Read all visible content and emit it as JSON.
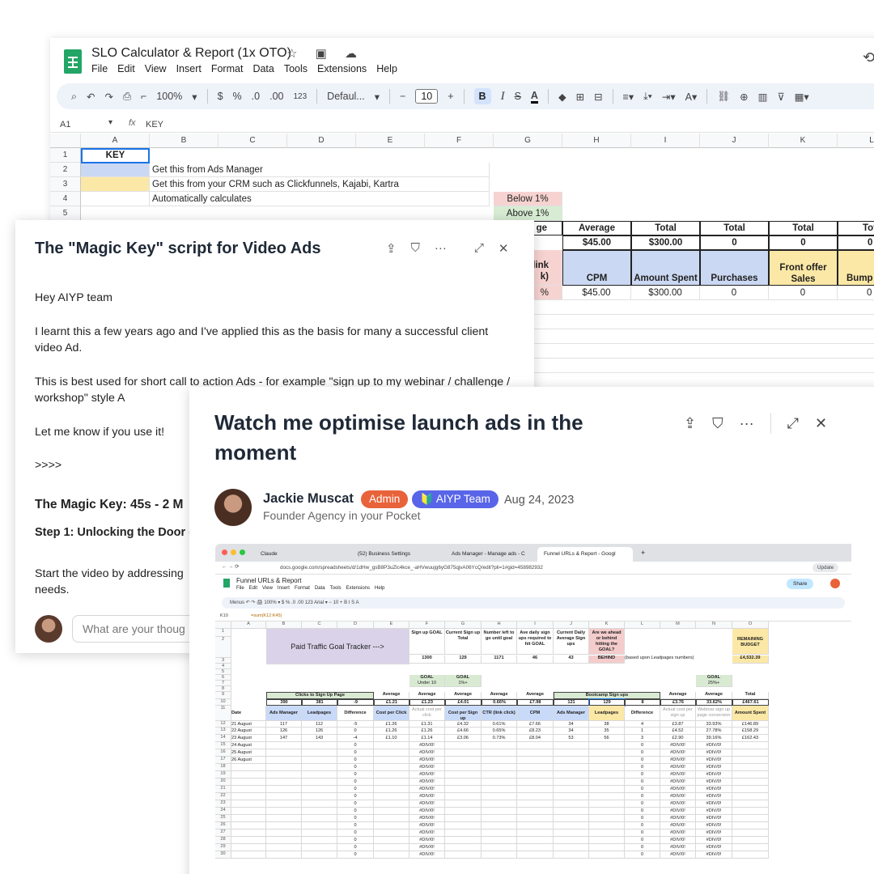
{
  "sheets": {
    "title": "SLO Calculator & Report (1x OTO)",
    "title_icons": "☆ ▣ ☁",
    "menu": [
      "File",
      "Edit",
      "View",
      "Insert",
      "Format",
      "Data",
      "Tools",
      "Extensions",
      "Help"
    ],
    "toolbar": {
      "zoom": "100%",
      "currency": "$",
      "percent": "%",
      "dec_less": ".0",
      "dec_more": ".00",
      "num_format": "123",
      "font": "Defaul...",
      "font_size": "10",
      "bold": "B",
      "italic": "I",
      "strike": "S",
      "text_color": "A"
    },
    "name_box": "A1",
    "fx": "fx",
    "formula_value": "KEY",
    "columns": [
      "A",
      "B",
      "C",
      "D",
      "E",
      "F",
      "G",
      "H",
      "I",
      "J",
      "K",
      "L"
    ],
    "rows": [
      "1",
      "2",
      "3",
      "4",
      "5"
    ],
    "cells": {
      "a1": "KEY",
      "b2": "Get this from Ads Manager",
      "b3": "Get this from your CRM such as Clickfunnels, Kajabi, Kartra",
      "b4": "Automatically calculates",
      "g4": "Below 1%",
      "g5": "Above 1%"
    },
    "summary": {
      "g_partial": "ge",
      "h_label": "Average",
      "h_value": "$45.00",
      "i_label": "Total",
      "i_value": "$300.00",
      "j_label": "Total",
      "j_value": "0",
      "k_label": "Total",
      "k_value": "0",
      "l_label": "Tot",
      "l_value": "0"
    },
    "headers": {
      "g_partial_1": "link",
      "g_partial_2": "k)",
      "h": "CPM",
      "i": "Amount Spent",
      "j": "Purchases",
      "k_1": "Front offer",
      "k_2": "Sales",
      "l": "Bump"
    },
    "data_row": {
      "g_partial": "%",
      "h": "$45.00",
      "i": "$300.00",
      "j": "0",
      "k": "0",
      "l": "0"
    }
  },
  "post1": {
    "title": "The \"Magic Key\" script for Video Ads",
    "paragraphs": [
      "Hey AIYP team",
      "I learnt this a few years ago and I've applied this as the basis for many a successful client video Ad.",
      "This is best used for short call to action Ads - for example \"sign up to my webinar / challenge / workshop\" style A",
      "Let me know if you use it!",
      ">>>>"
    ],
    "heading": "The Magic Key: 45s - 2 M",
    "step": "Step 1: Unlocking the Door (",
    "body_tail": "Start the video by addressing",
    "body_tail_2": "needs.",
    "comment_placeholder": "What are your thoug"
  },
  "post2": {
    "title": "Watch me optimise launch ads in the moment",
    "author": "Jackie Muscat",
    "badge_admin": "Admin",
    "badge_team": "🔰 AIYP Team",
    "date": "Aug 24, 2023",
    "subtitle": "Founder Agency in your Pocket"
  },
  "shot": {
    "tabs": [
      "Claude",
      "(52) Business Settings",
      "Ads Manager - Manage ads - C",
      "Funnel URLs & Report - Googl"
    ],
    "new_tab": "+",
    "url": "docs.google.com/spreadsheets/d/1dHw_gsB8P3uZlc4kce_-aHVwuujg6yG875qjvA06YcQ/edit?pli=1#gid=458982932",
    "update": "Update",
    "title": "Funnel URLs & Report",
    "menu": [
      "File",
      "Edit",
      "View",
      "Insert",
      "Format",
      "Data",
      "Tools",
      "Extensions",
      "Help"
    ],
    "share": "Share",
    "toolbar": "Menus   ↶  ↷  🖨  100%  ▾   $   %   .0  .00  123   Arial   ▾   −  10  +   B   I   S   A",
    "cell_ref": "K10",
    "formula": "=sum(K12:K45)",
    "cols": [
      "A",
      "B",
      "C",
      "D",
      "E",
      "F",
      "G",
      "H",
      "I",
      "J",
      "K",
      "L",
      "M",
      "N",
      "O"
    ],
    "tracker_label": "Paid Traffic Goal Tracker --->",
    "goal_headers": [
      "Sign up GOAL",
      "Current Sign up Total",
      "Number left to go until goal",
      "Ave daily sign ups required to hit GOAL",
      "Current Daily Average Sign ups",
      "Are we ahead or behind hitting the GOAL?"
    ],
    "goal_values": [
      "1300",
      "129",
      "1171",
      "46",
      "43",
      "BEHIND"
    ],
    "goal_note": "(based upon Leadpages numbers)",
    "budget_label": "REMAINING BUDGET",
    "budget_value": "£4,532.39",
    "goal_box": {
      "label_f": "GOAL",
      "val_f": "Under 10",
      "label_g": "GOAL",
      "val_g": "1%+",
      "label_n": "GOAL",
      "val_n": "25%+"
    },
    "section_left": "Clicks to Sign Up Page",
    "section_right": "Bootcamp Sign ups",
    "averages_row": {
      "b": "390",
      "c": "381",
      "d": "-9",
      "e": "£1.21",
      "f": "£1.23",
      "g": "£4.01",
      "h": "0.66%",
      "i": "£7.98",
      "j": "121",
      "k": "129",
      "l": "8",
      "m": "£3.76",
      "n": "33.62%",
      "o": "£467.61"
    },
    "avg_labels": {
      "e": "Average",
      "f": "Average",
      "g": "Average",
      "h": "Average",
      "i": "Average",
      "m": "Average",
      "n": "Average",
      "o": "Total"
    },
    "col_headers": [
      "Date",
      "Ads Manager",
      "Leadpages",
      "Difference",
      "Cost per Click",
      "Actual cost per click",
      "Cost per Sign up",
      "CTR (link click)",
      "CPM",
      "Ads Manager",
      "Leadpages",
      "Difference",
      "Actual cost per sign up",
      "Webinar sign up page conversion",
      "Amount Spent"
    ],
    "data_rows": [
      [
        "21 August",
        "117",
        "112",
        "-5",
        "£1.26",
        "£1.31",
        "£4.32",
        "0.61%",
        "£7.66",
        "34",
        "38",
        "4",
        "£3.87",
        "33.93%",
        "£146.89"
      ],
      [
        "22 August",
        "126",
        "126",
        "0",
        "£1.26",
        "£1.26",
        "£4.66",
        "0.65%",
        "£8.23",
        "34",
        "35",
        "1",
        "£4.52",
        "27.78%",
        "£158.29"
      ],
      [
        "23 August",
        "147",
        "143",
        "-4",
        "£1.10",
        "£1.14",
        "£3.06",
        "0.73%",
        "£8.04",
        "53",
        "56",
        "3",
        "£2.90",
        "39.16%",
        "£162.43"
      ],
      [
        "24 August",
        "",
        "",
        "0",
        "",
        "#DIV/0!",
        "",
        "",
        "",
        "",
        "",
        "0",
        "#DIV/0!",
        "#DIV/0!",
        ""
      ],
      [
        "25 August",
        "",
        "",
        "0",
        "",
        "#DIV/0!",
        "",
        "",
        "",
        "",
        "",
        "0",
        "#DIV/0!",
        "#DIV/0!",
        ""
      ],
      [
        "26 August",
        "",
        "",
        "0",
        "",
        "#DIV/0!",
        "",
        "",
        "",
        "",
        "",
        "0",
        "#DIV/0!",
        "#DIV/0!",
        ""
      ],
      [
        "",
        "",
        "",
        "0",
        "",
        "#DIV/0!",
        "",
        "",
        "",
        "",
        "",
        "0",
        "#DIV/0!",
        "#DIV/0!",
        ""
      ],
      [
        "",
        "",
        "",
        "0",
        "",
        "#DIV/0!",
        "",
        "",
        "",
        "",
        "",
        "0",
        "#DIV/0!",
        "#DIV/0!",
        ""
      ],
      [
        "",
        "",
        "",
        "0",
        "",
        "#DIV/0!",
        "",
        "",
        "",
        "",
        "",
        "0",
        "#DIV/0!",
        "#DIV/0!",
        ""
      ],
      [
        "",
        "",
        "",
        "0",
        "",
        "#DIV/0!",
        "",
        "",
        "",
        "",
        "",
        "0",
        "#DIV/0!",
        "#DIV/0!",
        ""
      ],
      [
        "",
        "",
        "",
        "0",
        "",
        "#DIV/0!",
        "",
        "",
        "",
        "",
        "",
        "0",
        "#DIV/0!",
        "#DIV/0!",
        ""
      ],
      [
        "",
        "",
        "",
        "0",
        "",
        "#DIV/0!",
        "",
        "",
        "",
        "",
        "",
        "0",
        "#DIV/0!",
        "#DIV/0!",
        ""
      ],
      [
        "",
        "",
        "",
        "0",
        "",
        "#DIV/0!",
        "",
        "",
        "",
        "",
        "",
        "0",
        "#DIV/0!",
        "#DIV/0!",
        ""
      ],
      [
        "",
        "",
        "",
        "0",
        "",
        "#DIV/0!",
        "",
        "",
        "",
        "",
        "",
        "0",
        "#DIV/0!",
        "#DIV/0!",
        ""
      ],
      [
        "",
        "",
        "",
        "0",
        "",
        "#DIV/0!",
        "",
        "",
        "",
        "",
        "",
        "0",
        "#DIV/0!",
        "#DIV/0!",
        ""
      ],
      [
        "",
        "",
        "",
        "0",
        "",
        "#DIV/0!",
        "",
        "",
        "",
        "",
        "",
        "0",
        "#DIV/0!",
        "#DIV/0!",
        ""
      ],
      [
        "",
        "",
        "",
        "0",
        "",
        "#DIV/0!",
        "",
        "",
        "",
        "",
        "",
        "0",
        "#DIV/0!",
        "#DIV/0!",
        ""
      ],
      [
        "",
        "",
        "",
        "0",
        "",
        "#DIV/0!",
        "",
        "",
        "",
        "",
        "",
        "0",
        "#DIV/0!",
        "#DIV/0!",
        ""
      ],
      [
        "",
        "",
        "",
        "0",
        "",
        "#DIV/0!",
        "",
        "",
        "",
        "",
        "",
        "0",
        "#DIV/0!",
        "#DIV/0!",
        ""
      ]
    ],
    "row_numbers": [
      "1",
      "2",
      "3",
      "4",
      "5",
      "6",
      "7",
      "8",
      "9",
      "10",
      "11",
      "12",
      "13",
      "14",
      "15",
      "16",
      "17",
      "18",
      "19",
      "20",
      "21",
      "22",
      "23",
      "24",
      "25",
      "26",
      "27",
      "28",
      "29",
      "30"
    ]
  },
  "colors": {
    "accent": "#1a73e8",
    "admin": "#e8633a",
    "team": "#5865e8",
    "sheets_green": "#23a566"
  }
}
